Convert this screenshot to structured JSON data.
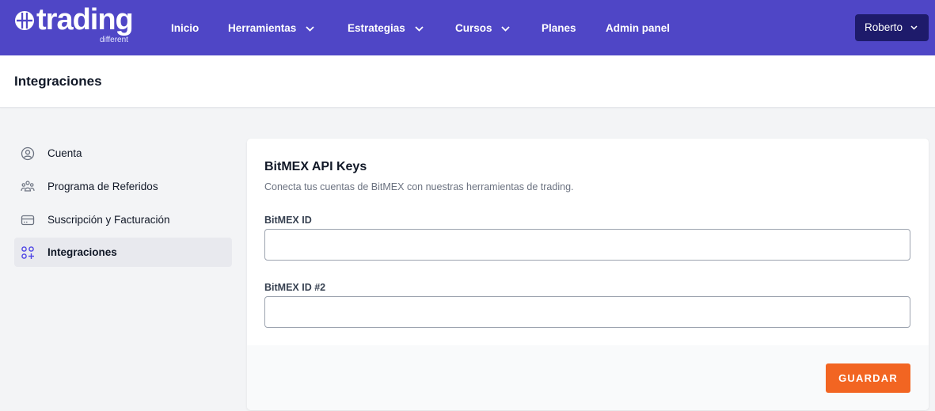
{
  "brand": {
    "name": "trading",
    "tagline": "different"
  },
  "nav": {
    "inicio": "Inicio",
    "herramientas": "Herramientas",
    "estrategias": "Estrategias",
    "cursos": "Cursos",
    "planes": "Planes",
    "admin": "Admin panel",
    "user": "Roberto"
  },
  "page": {
    "title": "Integraciones"
  },
  "sidebar": {
    "items": [
      {
        "label": "Cuenta",
        "icon": "user-circle-icon"
      },
      {
        "label": "Programa de Referidos",
        "icon": "users-icon"
      },
      {
        "label": "Suscripción y Facturación",
        "icon": "credit-card-icon"
      },
      {
        "label": "Integraciones",
        "icon": "apps-add-icon"
      }
    ],
    "active_index": 3
  },
  "card": {
    "title": "BitMEX API Keys",
    "subtitle": "Conecta tus cuentas de BitMEX con nuestras herramientas de trading.",
    "field1_label": "BitMEX ID",
    "field1_value": "",
    "field2_label": "BitMEX ID #2",
    "field2_value": "",
    "save_label": "GUARDAR"
  },
  "colors": {
    "navbar": "#4f46c6",
    "user_button": "#1e1b6b",
    "accent": "#f26522",
    "background": "#f3f4f6"
  }
}
